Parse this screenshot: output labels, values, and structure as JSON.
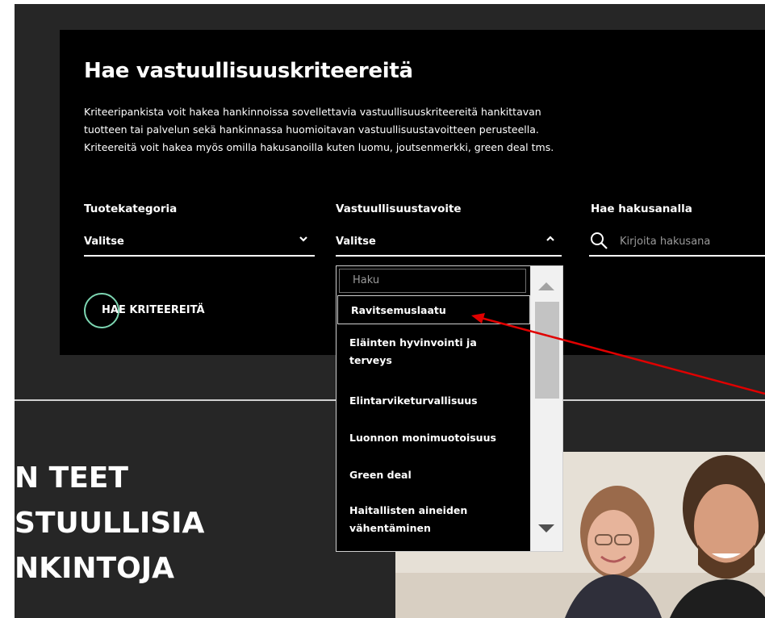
{
  "card": {
    "title": "Hae vastuullisuuskriteereitä",
    "description": [
      "Kriteeripankista voit hakea hankinnoissa sovellettavia vastuullisuuskriteereitä hankittavan",
      "tuotteen tai palvelun sekä hankinnassa huomioitavan vastuullisuustavoitteen perusteella.",
      "Kriteereitä voit hakea myös omilla hakusanoilla kuten luomu, joutsenmerkki, green deal tms."
    ]
  },
  "filters": {
    "category": {
      "label": "Tuotekategoria",
      "value": "Valitse",
      "chevron": "chevron-down-icon"
    },
    "goal": {
      "label": "Vastuullisuustavoite",
      "value": "Valitse",
      "chevron": "chevron-up-icon"
    },
    "keyword": {
      "label": "Hae hakusanalla",
      "placeholder": "Kirjoita hakusana",
      "icon": "search-icon"
    }
  },
  "search_button": {
    "label": "HAE KRITEEREITÄ"
  },
  "dropdown": {
    "search_placeholder": "Haku",
    "options": [
      "Ravitsemuslaatu",
      "Eläinten hyvinvointi ja terveys",
      "Elintarviketurvallisuus",
      "Luonnon monimuotoisuus",
      "Green deal",
      "Haitallisten aineiden vähentäminen"
    ],
    "highlighted": "Ravitsemuslaatu"
  },
  "hero": {
    "lines": [
      "N TEET",
      "STUULLISIA",
      "NKINTOJA"
    ]
  },
  "colors": {
    "accent": "#7dd6b2",
    "background": "#262626",
    "card": "#000000",
    "annotation": "#e00000"
  }
}
